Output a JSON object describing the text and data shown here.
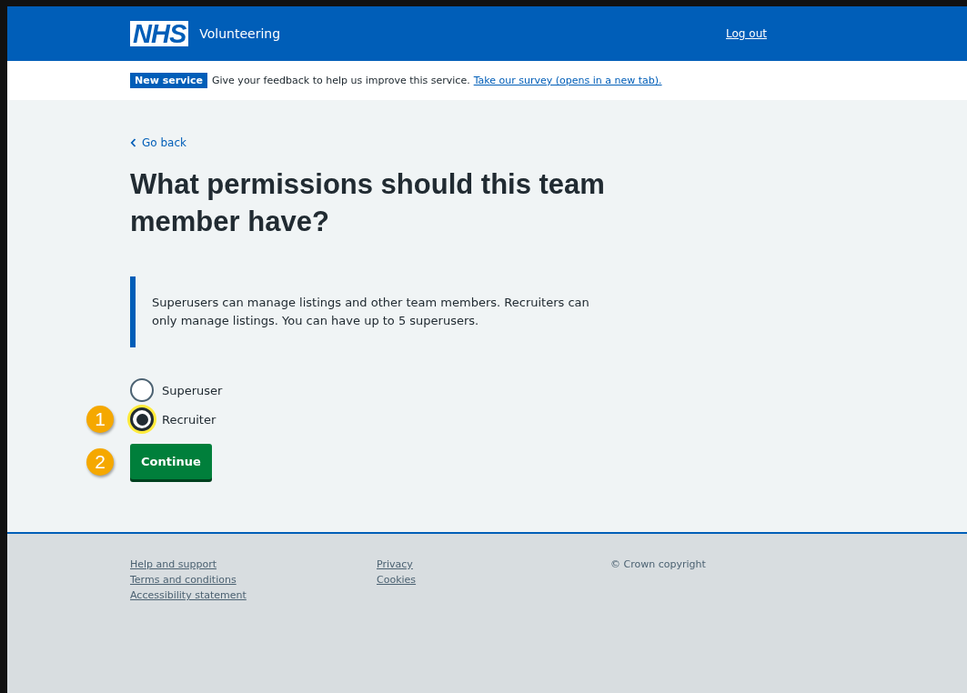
{
  "header": {
    "logo": "NHS",
    "service": "Volunteering",
    "logout": "Log out"
  },
  "phase_banner": {
    "tag": "New service",
    "text": "Give your feedback to help us improve this service.",
    "link": "Take our survey (opens in a new tab)."
  },
  "back_link": "Go back",
  "heading": "What permissions should this team member have?",
  "inset": "Superusers can manage listings and other team members. Recruiters can only manage listings. You can have up to 5 superusers.",
  "radios": [
    {
      "label": "Superuser",
      "selected": false,
      "focused": false
    },
    {
      "label": "Recruiter",
      "selected": true,
      "focused": true,
      "callout": "1"
    }
  ],
  "continue": {
    "label": "Continue",
    "callout": "2"
  },
  "footer": {
    "columns": [
      [
        "Help and support",
        "Terms and conditions",
        "Accessibility statement"
      ],
      [
        "Privacy",
        "Cookies"
      ]
    ],
    "copyright": "© Crown copyright"
  }
}
